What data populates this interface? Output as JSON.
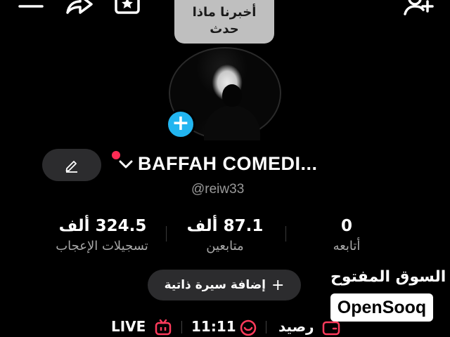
{
  "top_bar": {
    "icons": [
      "menu-icon",
      "share-icon",
      "star-box-icon",
      "add-user-icon"
    ]
  },
  "avatar": {
    "bubble_line1": "أخبرنا ماذا",
    "bubble_line2": "حدث",
    "add_glyph": "+"
  },
  "profile": {
    "name": "BAFFAH COMEDI...",
    "handle": "@reiw33",
    "edit_icon": "pencil-icon",
    "notification_dot_color": "#ff2b55"
  },
  "stats": [
    {
      "value": "324.5 ألف",
      "label": "تسجيلات الإعجاب"
    },
    {
      "value": "87.1 ألف",
      "label": "متابعين"
    },
    {
      "value": "0",
      "label": "أتابعه"
    }
  ],
  "bio_button": {
    "label": "إضافة سيرة ذاتية",
    "icon": "+"
  },
  "watermark": {
    "arabic": "السوق المفتوح",
    "latin": "OpenSooq"
  },
  "bottom_row": {
    "live_label": "LIVE",
    "time_label": "11:11",
    "balance_label": "رصيد"
  },
  "colors": {
    "accent_blue": "#22b5f0",
    "live_red": "#ff3b5c",
    "background": "#000000"
  }
}
